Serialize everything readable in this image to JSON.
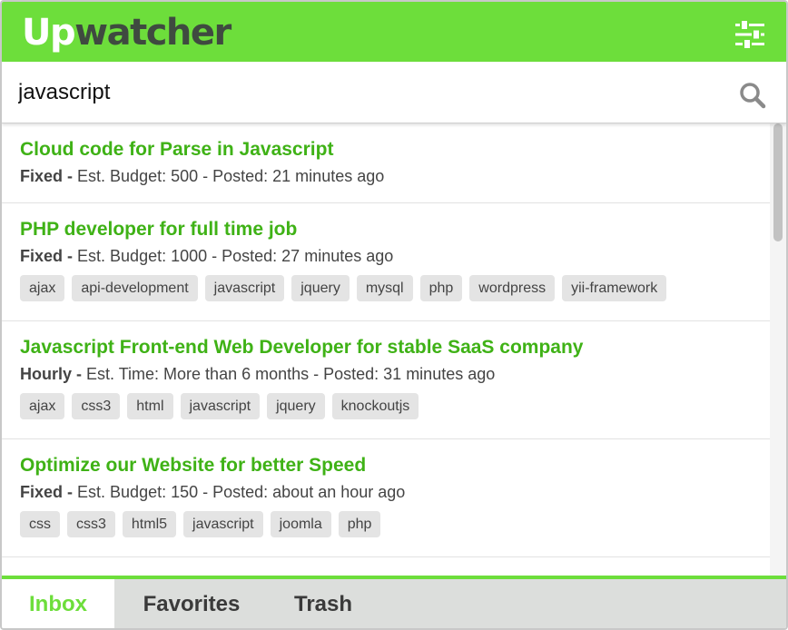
{
  "app": {
    "logo_up": "Up",
    "logo_rest": "watcher",
    "filter_icon": "sliders-icon"
  },
  "search": {
    "value": "javascript",
    "icon": "search-icon"
  },
  "jobs": [
    {
      "title": "Cloud code for Parse in Javascript",
      "kind": "Fixed -",
      "details": "Est. Budget: 500 - Posted: 21 minutes ago",
      "tags": []
    },
    {
      "title": "PHP developer for full time job",
      "kind": "Fixed -",
      "details": "Est. Budget: 1000 - Posted: 27 minutes ago",
      "tags": [
        "ajax",
        "api-development",
        "javascript",
        "jquery",
        "mysql",
        "php",
        "wordpress",
        "yii-framework"
      ]
    },
    {
      "title": "Javascript Front-end Web Developer for stable SaaS company",
      "kind": "Hourly -",
      "details": "Est. Time: More than 6 months - Posted: 31 minutes ago",
      "tags": [
        "ajax",
        "css3",
        "html",
        "javascript",
        "jquery",
        "knockoutjs"
      ]
    },
    {
      "title": "Optimize our Website for better Speed",
      "kind": "Fixed -",
      "details": "Est. Budget: 150 - Posted: about an hour ago",
      "tags": [
        "css",
        "css3",
        "html5",
        "javascript",
        "joomla",
        "php"
      ]
    }
  ],
  "tabs": {
    "inbox": "Inbox",
    "favorites": "Favorites",
    "trash": "Trash",
    "active": "Inbox"
  },
  "colors": {
    "brand_green": "#6dde3b",
    "title_green": "#3fb216",
    "logo_dark": "#3f4a40",
    "tab_bar_bg": "#dcdedc",
    "tag_bg": "#e4e4e4"
  }
}
